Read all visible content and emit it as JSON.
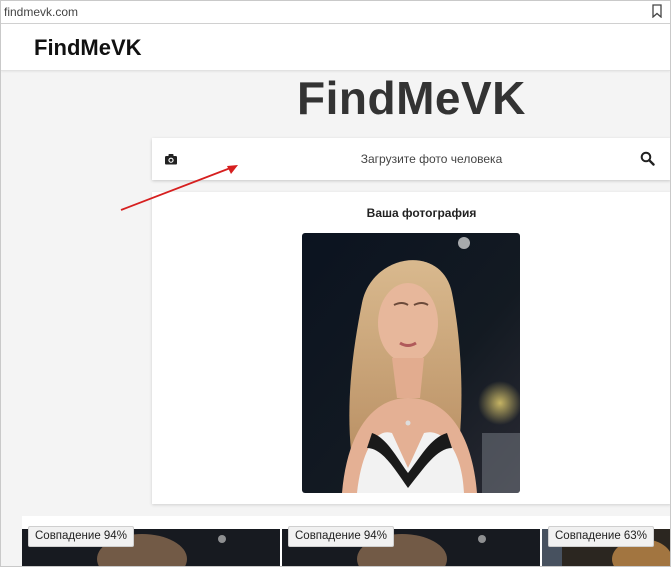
{
  "browser": {
    "url": "findmevk.com",
    "bookmark_icon": "bookmark-icon"
  },
  "navbar": {
    "brand": "FindMeVK"
  },
  "hero": {
    "title": "FindMeVK"
  },
  "search": {
    "placeholder": "Загрузите фото человека",
    "left_icon": "camera-icon",
    "right_icon": "search-icon"
  },
  "photo_card": {
    "title": "Ваша фотография"
  },
  "results": [
    {
      "match": "Совпадение 94%"
    },
    {
      "match": "Совпадение 94%"
    },
    {
      "match": "Совпадение 63%"
    }
  ],
  "colors": {
    "annotation_arrow": "#d61f1f",
    "page_background": "#f4f4f4"
  }
}
